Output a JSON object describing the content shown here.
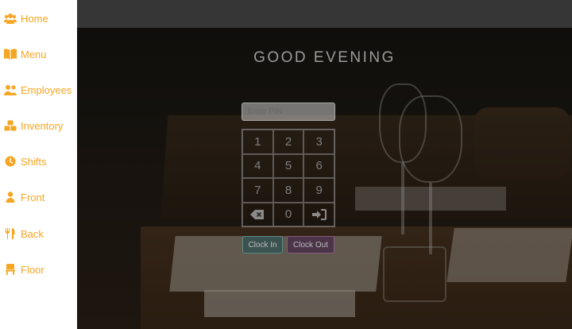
{
  "sidebar": {
    "items": [
      {
        "label": "Home",
        "icon": "users-icon"
      },
      {
        "label": "Menu",
        "icon": "book-icon"
      },
      {
        "label": "Employees",
        "icon": "users-icon"
      },
      {
        "label": "Inventory",
        "icon": "boxes-icon"
      },
      {
        "label": "Shifts",
        "icon": "clock-icon"
      },
      {
        "label": "Front",
        "icon": "user-icon"
      },
      {
        "label": "Back",
        "icon": "utensils-icon"
      },
      {
        "label": "Floor",
        "icon": "chair-icon"
      }
    ]
  },
  "colors": {
    "accent": "#f5a623",
    "clock_in": "#5a8b86",
    "clock_out": "#8a5a80"
  },
  "greeting": "GOOD EVENING",
  "pin": {
    "placeholder": "Enter PIN",
    "value": ""
  },
  "keypad": {
    "keys": [
      "1",
      "2",
      "3",
      "4",
      "5",
      "6",
      "7",
      "8",
      "9",
      "backspace-icon",
      "0",
      "sign-in-icon"
    ],
    "k1": "1",
    "k2": "2",
    "k3": "3",
    "k4": "4",
    "k5": "5",
    "k6": "6",
    "k7": "7",
    "k8": "8",
    "k9": "9",
    "k0": "0"
  },
  "buttons": {
    "clock_in": "Clock In",
    "clock_out": "Clock Out"
  }
}
